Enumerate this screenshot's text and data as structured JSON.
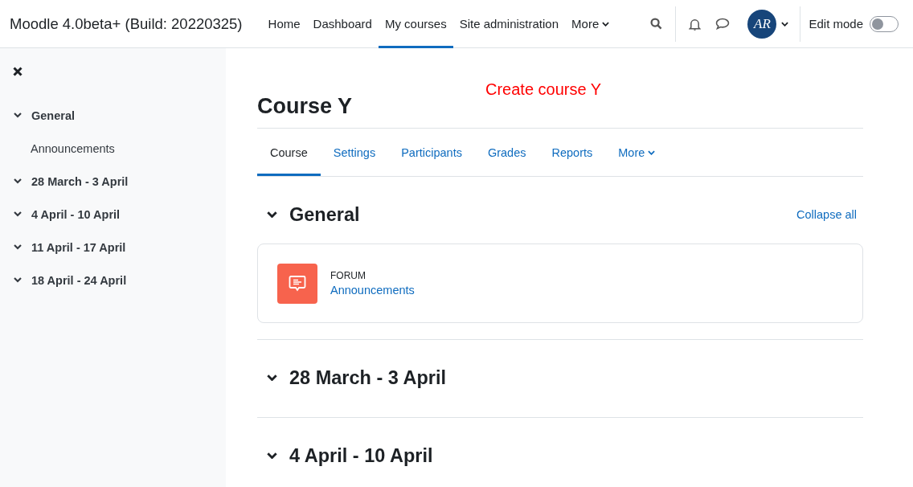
{
  "site_title": "Moodle 4.0beta+ (Build: 20220325)",
  "primary_nav": [
    {
      "label": "Home",
      "selected": false,
      "kind": "link"
    },
    {
      "label": "Dashboard",
      "selected": false,
      "kind": "link"
    },
    {
      "label": "My courses",
      "selected": true,
      "kind": "link"
    },
    {
      "label": "Site administration",
      "selected": false,
      "kind": "link"
    },
    {
      "label": "More",
      "selected": false,
      "kind": "dropdown"
    }
  ],
  "user_menu": {
    "initials": "AR"
  },
  "edit_mode": {
    "label": "Edit mode",
    "on": false
  },
  "course_index": {
    "sections": [
      {
        "title": "General",
        "expanded": true,
        "children": [
          {
            "title": "Announcements"
          }
        ]
      },
      {
        "title": "28 March - 3 April",
        "expanded": true
      },
      {
        "title": "4 April - 10 April",
        "expanded": true
      },
      {
        "title": "11 April - 17 April",
        "expanded": true
      },
      {
        "title": "18 April - 24 April",
        "expanded": true
      }
    ]
  },
  "annotation": "Create course Y",
  "course": {
    "title": "Course Y",
    "tabs": [
      {
        "label": "Course",
        "selected": true,
        "kind": "link"
      },
      {
        "label": "Settings",
        "selected": false,
        "kind": "link"
      },
      {
        "label": "Participants",
        "selected": false,
        "kind": "link"
      },
      {
        "label": "Grades",
        "selected": false,
        "kind": "link"
      },
      {
        "label": "Reports",
        "selected": false,
        "kind": "link"
      },
      {
        "label": "More",
        "selected": false,
        "kind": "dropdown"
      }
    ],
    "collapse_all": "Collapse all",
    "sections": [
      {
        "title": "General",
        "expanded": true,
        "activities": [
          {
            "kind": "forum",
            "type_label": "FORUM",
            "name": "Announcements"
          }
        ]
      },
      {
        "title": "28 March - 3 April",
        "expanded": true
      },
      {
        "title": "4 April - 10 April",
        "expanded": true
      }
    ]
  }
}
